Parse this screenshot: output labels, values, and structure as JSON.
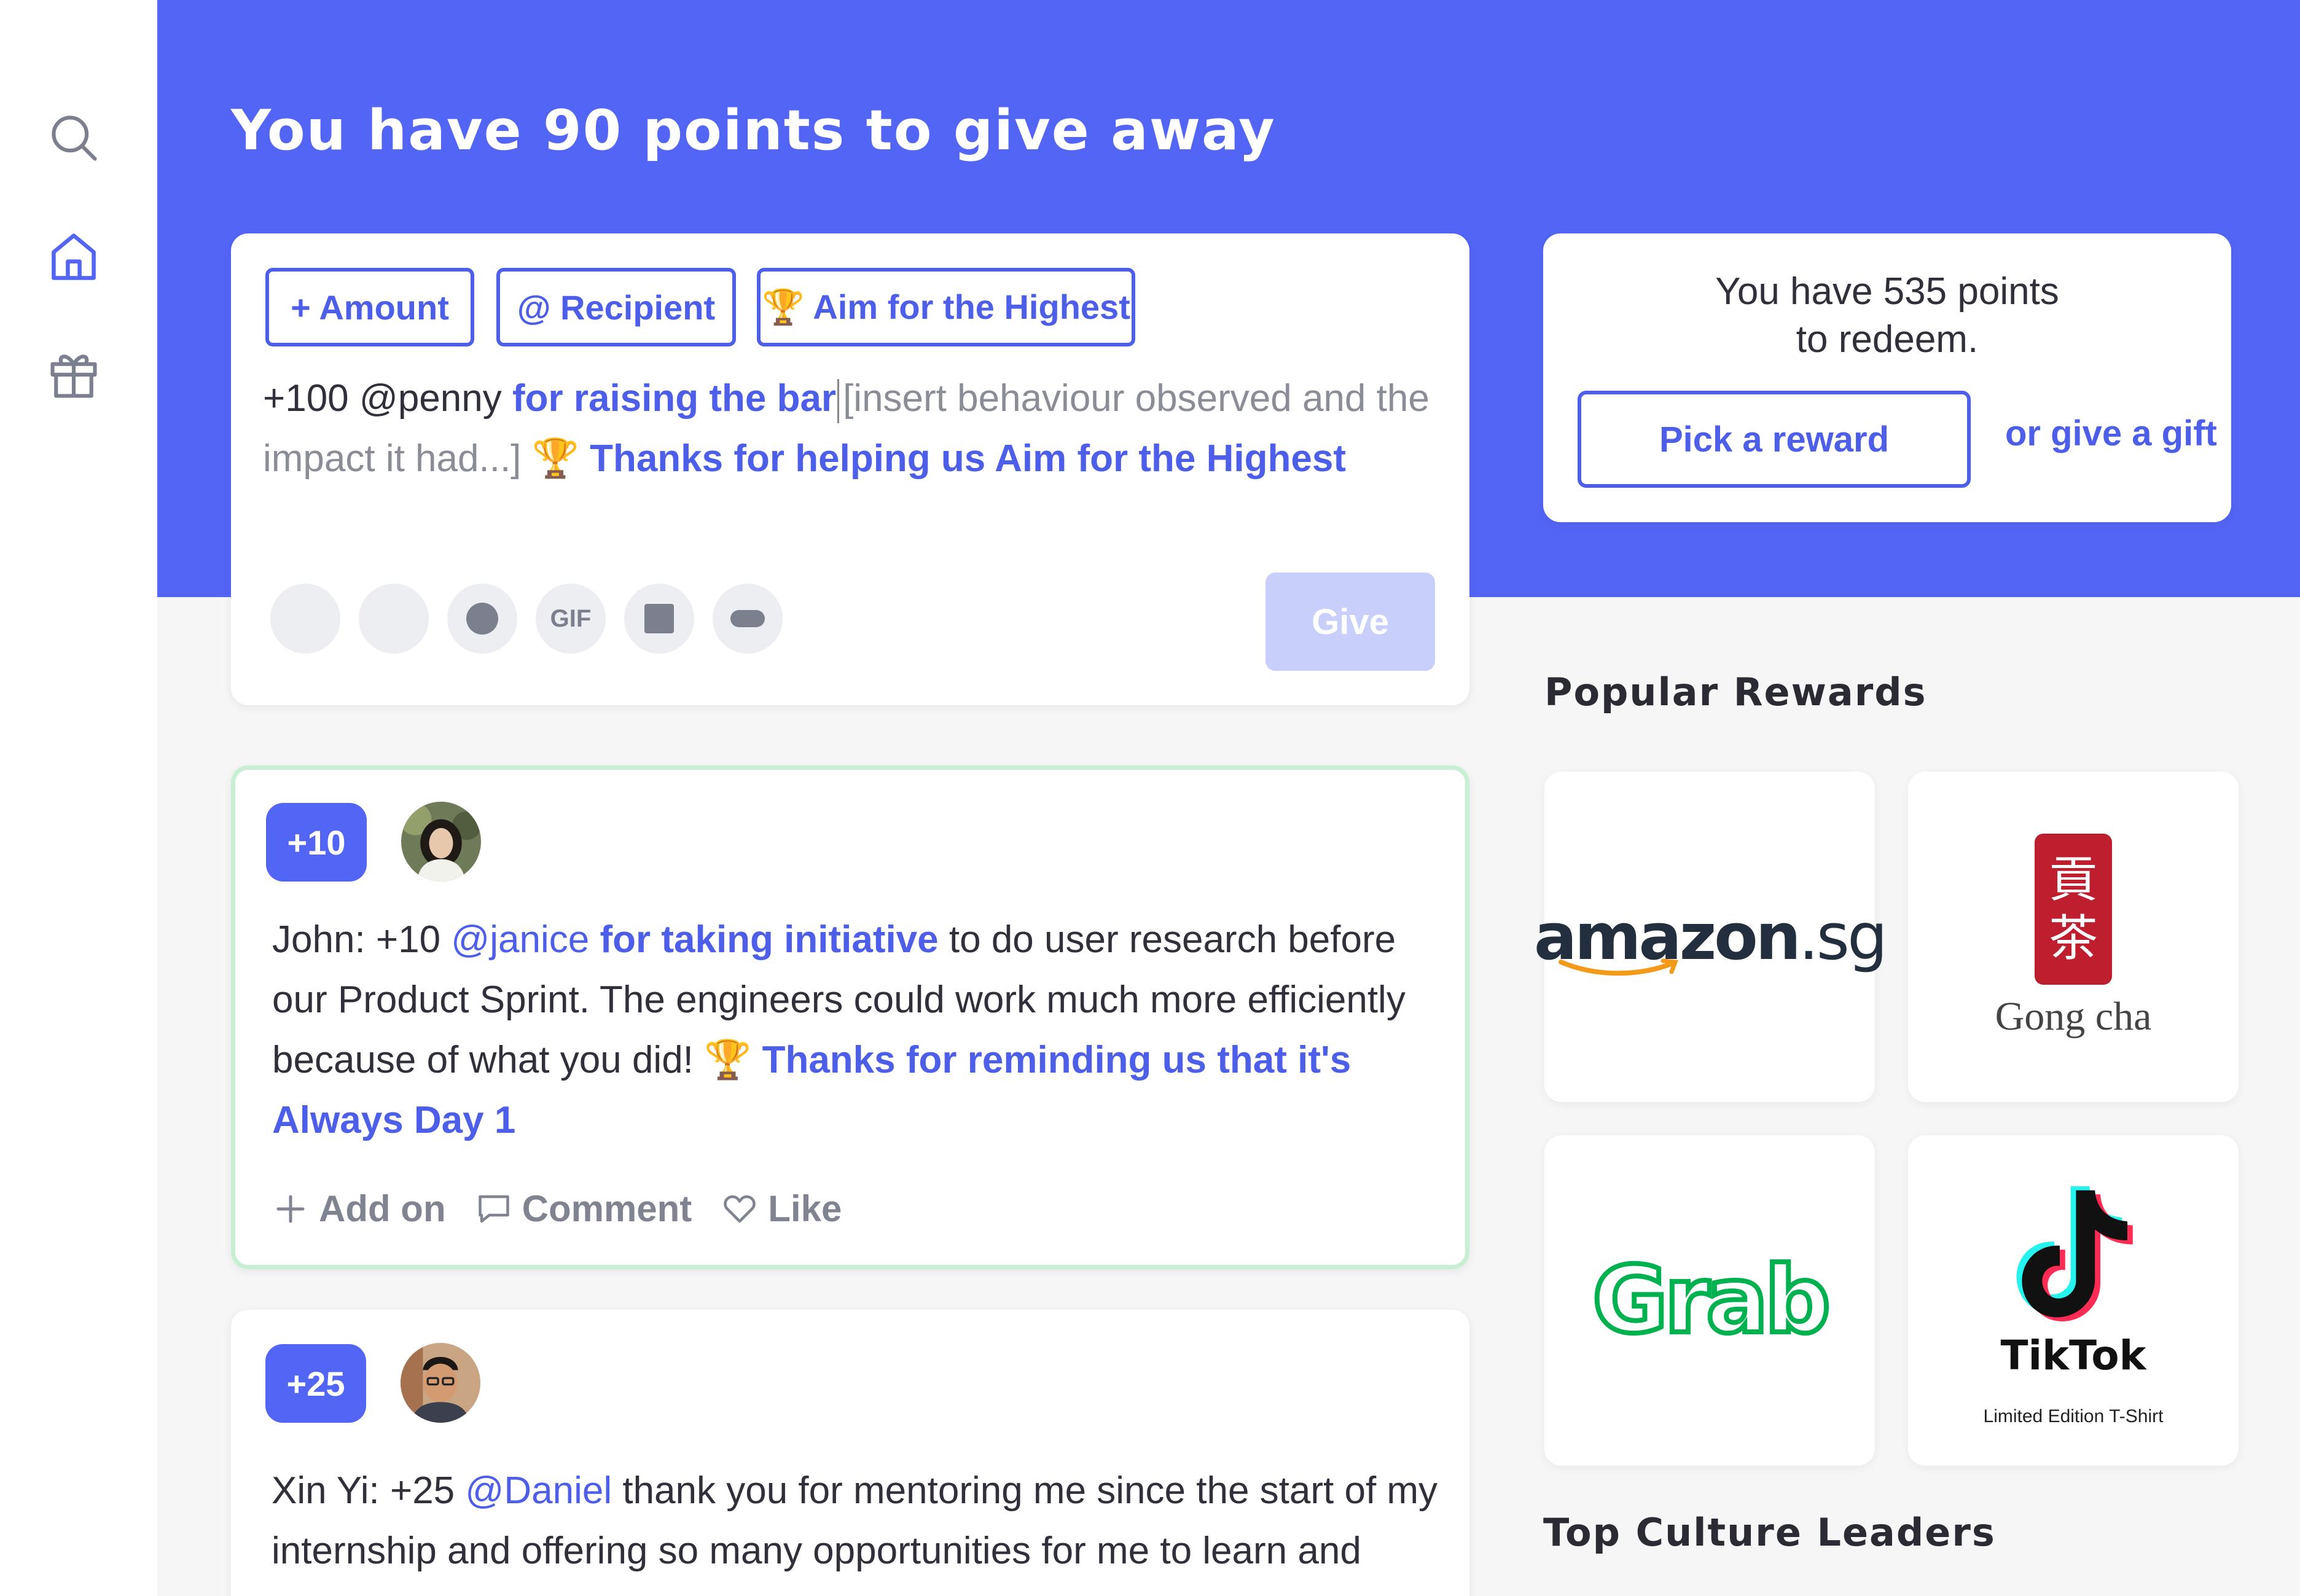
{
  "sidebar": {
    "icons": [
      "search-icon",
      "home-icon",
      "gift-icon"
    ]
  },
  "header": {
    "title": "You have 90 points to give away"
  },
  "compose": {
    "chips": [
      "+ Amount",
      "@ Recipient",
      "🏆 Aim for the Highest"
    ],
    "text_prefix": "+100 @penny ",
    "text_highlight": "for raising the bar",
    "text_placeholder": "[insert behaviour observed and the impact it had...] ",
    "text_trophy": "🏆 ",
    "text_value": "Thanks for helping us Aim for the Highest",
    "tools": [
      "emoji-icon",
      "mention-icon",
      "record-icon",
      "GIF",
      "image-icon",
      "tag-icon"
    ],
    "gif_label": "GIF",
    "give_label": "Give"
  },
  "redeem": {
    "line1": "You have 535 points",
    "line2": "to redeem.",
    "pick_label": "Pick a reward",
    "gift_label": "or give a gift"
  },
  "posts": [
    {
      "points": "+10",
      "author": "John: +10 ",
      "mention": "@janice",
      "highlight": " for taking initiative",
      "body": " to do user research before our Product Sprint. The engineers could work much more efficiently because of what you did! ",
      "trophy": "🏆 ",
      "value": "Thanks for reminding us that it's Always Day 1",
      "actions": [
        "Add on",
        "Comment",
        "Like"
      ]
    },
    {
      "points": "+25",
      "author": "Xin Yi: +25 ",
      "mention": "@Daniel",
      "body": " thank you for mentoring me since the start of my internship and offering so many opportunities for me to learn and"
    }
  ],
  "rewards": {
    "title": "Popular Rewards",
    "items": [
      {
        "brand": "amazon",
        "text": "amazon",
        "suffix": ".sg"
      },
      {
        "brand": "gongcha",
        "seal_top": "貢",
        "seal_bottom": "茶",
        "text": "Gong cha"
      },
      {
        "brand": "grab",
        "text": "Grab"
      },
      {
        "brand": "tiktok",
        "text": "TikTok",
        "subtitle": "Limited Edition T-Shirt"
      }
    ]
  },
  "leaders": {
    "title": "Top Culture Leaders"
  },
  "colors": {
    "brand": "#5365f5",
    "accent_text": "#4d5ee9",
    "give_disabled": "#c9cffb",
    "post_highlight_border": "#c7efd4"
  }
}
